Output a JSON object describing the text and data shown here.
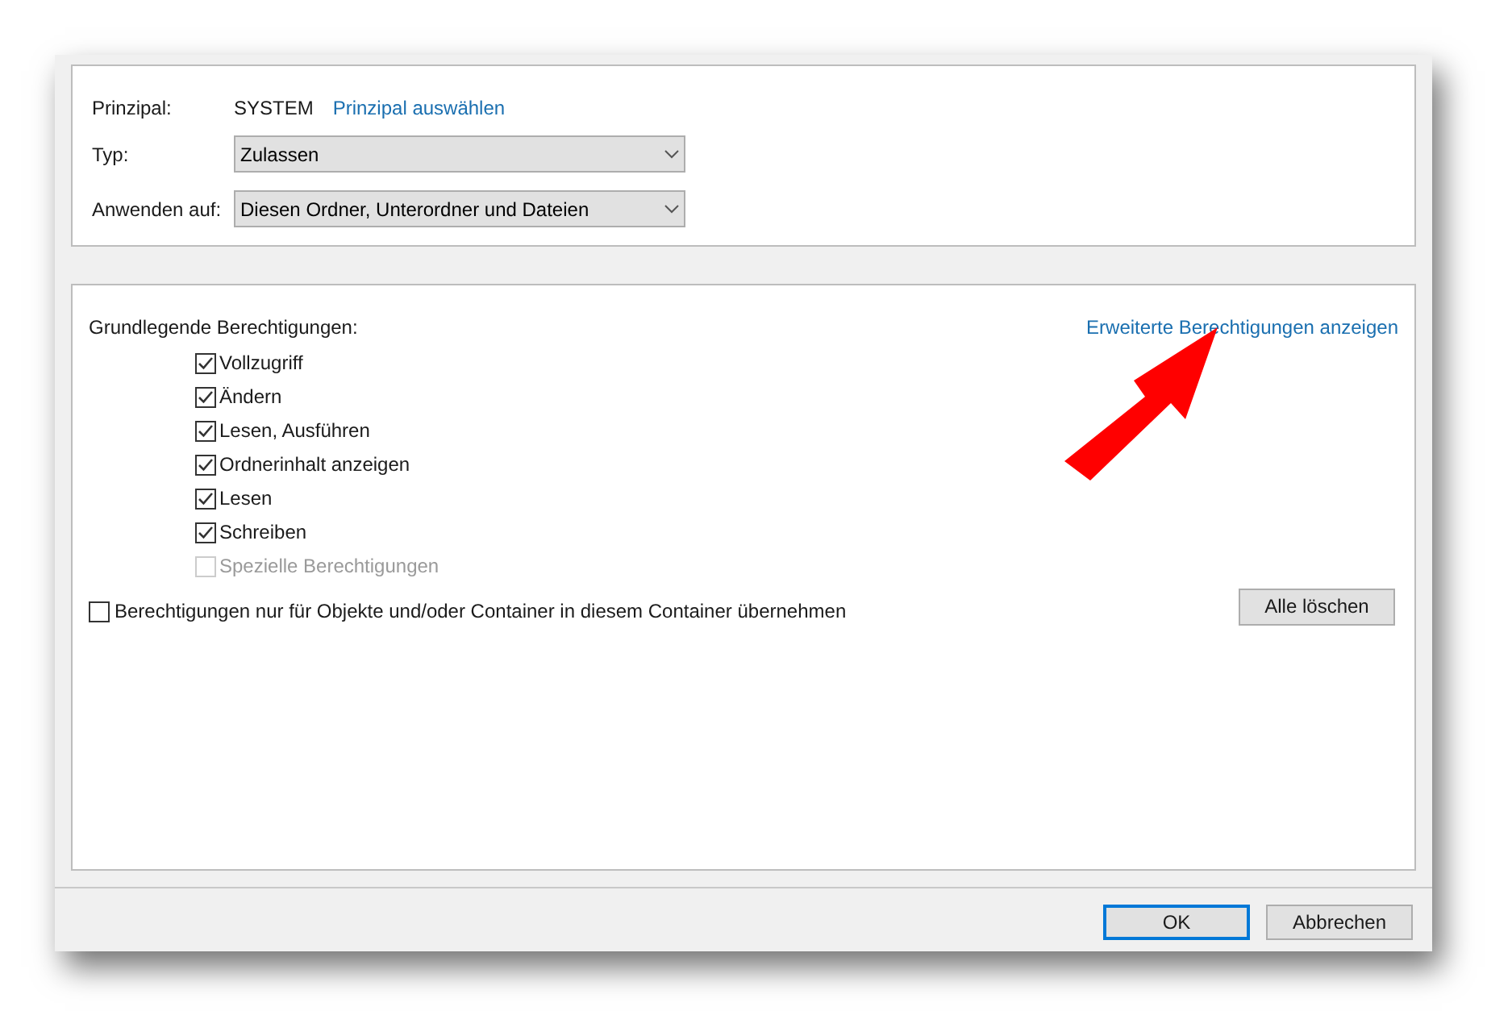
{
  "principal": {
    "label": "Prinzipal:",
    "value": "SYSTEM",
    "link": "Prinzipal auswählen"
  },
  "type_field": {
    "label": "Typ:",
    "value": "Zulassen"
  },
  "apply_to": {
    "label": "Anwenden auf:",
    "value": "Diesen Ordner, Unterordner und Dateien"
  },
  "permissions": {
    "title": "Grundlegende Berechtigungen:",
    "advanced_link": "Erweiterte Berechtigungen anzeigen",
    "items": [
      {
        "label": "Vollzugriff",
        "checked": true,
        "disabled": false
      },
      {
        "label": "Ändern",
        "checked": true,
        "disabled": false
      },
      {
        "label": "Lesen, Ausführen",
        "checked": true,
        "disabled": false
      },
      {
        "label": "Ordnerinhalt anzeigen",
        "checked": true,
        "disabled": false
      },
      {
        "label": "Lesen",
        "checked": true,
        "disabled": false
      },
      {
        "label": "Schreiben",
        "checked": true,
        "disabled": false
      },
      {
        "label": "Spezielle Berechtigungen",
        "checked": false,
        "disabled": true
      }
    ],
    "inherit": {
      "label": "Berechtigungen nur für Objekte und/oder Container in diesem Container übernehmen",
      "checked": false
    },
    "clear_button": "Alle löschen"
  },
  "buttons": [
    {
      "label": "OK",
      "selected": true
    },
    {
      "label": "Abbrechen",
      "selected": false
    }
  ]
}
